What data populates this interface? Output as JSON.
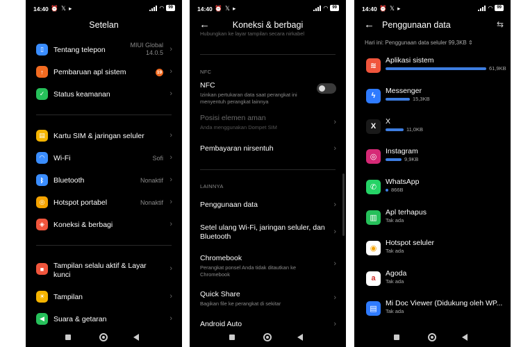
{
  "status": {
    "time": "14:40",
    "icons": "⏰ 𝕏 ▸",
    "battery": "99"
  },
  "screen1": {
    "title": "Setelan",
    "group1": [
      {
        "label": "Tentang telepon",
        "value_line1": "MIUI Global",
        "value_line2": "14.0.5",
        "icon": "phone-icon",
        "color": "#3a8dff"
      },
      {
        "label": "Pembaruan apl sistem",
        "badge": "19",
        "icon": "arrow-up-icon",
        "color": "#f26b21"
      },
      {
        "label": "Status keamanan",
        "icon": "shield-check-icon",
        "color": "#26c05a"
      }
    ],
    "group2": [
      {
        "label": "Kartu SIM & jaringan seluler",
        "icon": "sim-icon",
        "color": "#f5b400"
      },
      {
        "label": "Wi-Fi",
        "value": "Sofi",
        "icon": "wifi-icon",
        "color": "#3a8dff"
      },
      {
        "label": "Bluetooth",
        "value": "Nonaktif",
        "icon": "bluetooth-icon",
        "color": "#3a8dff"
      },
      {
        "label": "Hotspot portabel",
        "value": "Nonaktif",
        "icon": "hotspot-icon",
        "color": "#f5a300"
      },
      {
        "label": "Koneksi & berbagi",
        "icon": "share-icon",
        "color": "#f0553c"
      }
    ],
    "group3": [
      {
        "label": "Tampilan selalu aktif & Layar kunci",
        "icon": "lock-icon",
        "color": "#f0553c"
      },
      {
        "label": "Tampilan",
        "icon": "sun-icon",
        "color": "#f5b400"
      },
      {
        "label": "Suara & getaran",
        "icon": "speaker-icon",
        "color": "#26c05a"
      }
    ]
  },
  "screen2": {
    "title": "Koneksi & berbagi",
    "faded_text": "Hubungkan ke layar tampilan secara nirkabel",
    "section_nfc": "NFC",
    "nfc": {
      "title": "NFC",
      "desc": "Izinkan pertukaran data saat perangkat ini menyentuh perangkat lainnya",
      "enabled": false
    },
    "secure_element": {
      "title": "Posisi elemen aman",
      "desc": "Anda menggunakan Dompet SIM"
    },
    "contactless": {
      "title": "Pembayaran nirsentuh"
    },
    "section_other": "LAINNYA",
    "data_usage": {
      "title": "Penggunaan data"
    },
    "reset": {
      "title": "Setel ulang Wi-Fi, jaringan seluler, dan Bluetooth"
    },
    "chromebook": {
      "title": "Chromebook",
      "desc": "Perangkat ponsel Anda tidak ditautkan ke Chromebook"
    },
    "quick_share": {
      "title": "Quick Share",
      "desc": "Bagikan file ke perangkat di sekitar"
    },
    "android_auto": {
      "title": "Android Auto"
    }
  },
  "screen3": {
    "title": "Penggunaan data",
    "today": "Hari ini: Penggunaan data seluler 99,3KB",
    "apps": [
      {
        "name": "Aplikasi sistem",
        "usage": "61,9KB",
        "fraction": 0.62,
        "icon": "layers-icon",
        "color": "#f0553c"
      },
      {
        "name": "Messenger",
        "usage": "15,3KB",
        "fraction": 0.15,
        "icon": "messenger-icon",
        "color": "#2f7bff"
      },
      {
        "name": "X",
        "usage": "11,0KB",
        "fraction": 0.11,
        "icon": "x-logo-icon",
        "color": "#1a1a1a"
      },
      {
        "name": "Instagram",
        "usage": "9,9KB",
        "fraction": 0.1,
        "icon": "instagram-icon",
        "color": "#d62976"
      },
      {
        "name": "WhatsApp",
        "usage": "866B",
        "fraction": 0.01,
        "icon": "whatsapp-icon",
        "color": "#25d366"
      },
      {
        "name": "Apl terhapus",
        "usage": "Tak ada",
        "fraction": 0,
        "icon": "trash-icon",
        "color": "#26c05a"
      },
      {
        "name": "Hotspot seluler",
        "usage": "Tak ada",
        "fraction": 0,
        "icon": "hotspot-icon",
        "color": "#ffffff"
      },
      {
        "name": "Agoda",
        "usage": "Tak ada",
        "fraction": 0,
        "icon": "agoda-icon",
        "color": "#ffffff"
      },
      {
        "name": "Mi Doc Viewer (Didukung oleh WP...",
        "usage": "Tak ada",
        "fraction": 0,
        "icon": "document-icon",
        "color": "#2f7bff"
      }
    ]
  }
}
